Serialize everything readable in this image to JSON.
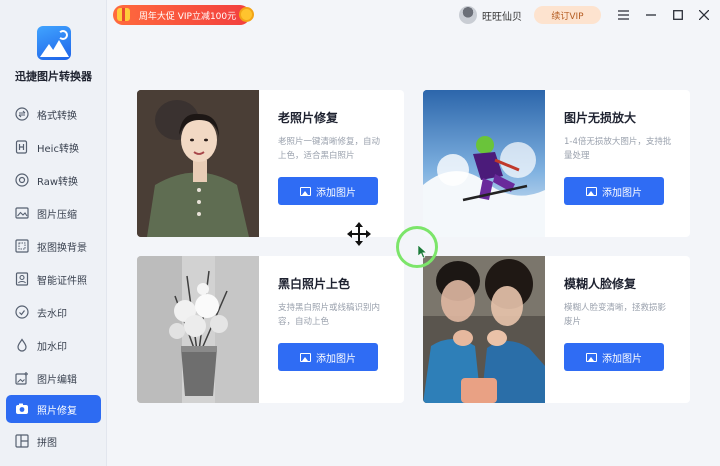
{
  "app": {
    "name": "迅捷图片转换器"
  },
  "promo": {
    "text": "周年大促 VIP立减100元"
  },
  "user": {
    "name": "旺旺仙贝",
    "vip_label": "续订VIP"
  },
  "window_controls": [
    "menu-icon",
    "minimize-icon",
    "maximize-icon",
    "close-icon"
  ],
  "sidebar": {
    "items": [
      {
        "label": "格式转换",
        "icon": "format-convert-icon",
        "active": false
      },
      {
        "label": "Heic转换",
        "icon": "heic-icon",
        "active": false
      },
      {
        "label": "Raw转换",
        "icon": "raw-icon",
        "active": false
      },
      {
        "label": "图片压缩",
        "icon": "compress-icon",
        "active": false
      },
      {
        "label": "抠图换背景",
        "icon": "cutout-icon",
        "active": false
      },
      {
        "label": "智能证件照",
        "icon": "id-photo-icon",
        "active": false
      },
      {
        "label": "去水印",
        "icon": "remove-watermark-icon",
        "active": false
      },
      {
        "label": "加水印",
        "icon": "add-watermark-icon",
        "active": false
      },
      {
        "label": "图片编辑",
        "icon": "image-edit-icon",
        "active": false
      },
      {
        "label": "照片修复",
        "icon": "photo-repair-icon",
        "active": true
      },
      {
        "label": "拼图",
        "icon": "collage-icon",
        "active": false
      }
    ]
  },
  "cards": [
    {
      "title": "老照片修复",
      "desc": "老照片一键清晰修复，自动上色，适合黑白照片",
      "button": "添加图片"
    },
    {
      "title": "图片无损放大",
      "desc": "1-4倍无损放大图片，支持批量处理",
      "button": "添加图片"
    },
    {
      "title": "黑白照片上色",
      "desc": "支持黑白照片或线稿识别内容，自动上色",
      "button": "添加图片"
    },
    {
      "title": "模糊人脸修复",
      "desc": "模糊人脸变清晰，拯救损影废片",
      "button": "添加图片"
    }
  ],
  "colors": {
    "accent": "#2f6cf4",
    "promo": "#f23f3f",
    "cursor_ring": "#7ce56a"
  }
}
